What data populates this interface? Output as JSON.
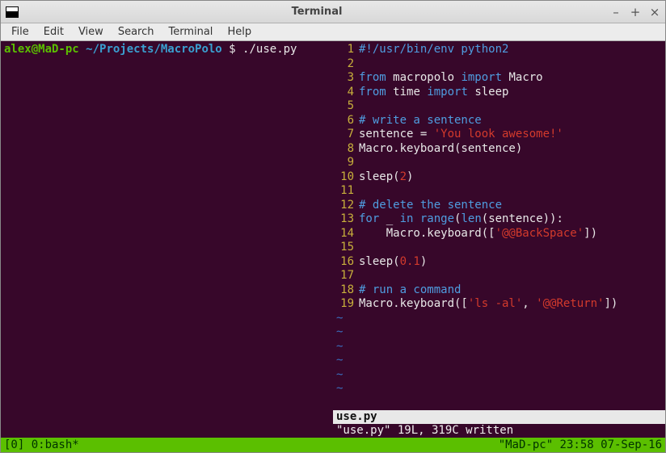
{
  "window": {
    "title": "Terminal",
    "minimize": "–",
    "maximize": "+",
    "close": "×"
  },
  "menubar": {
    "items": [
      "File",
      "Edit",
      "View",
      "Search",
      "Terminal",
      "Help"
    ]
  },
  "left_prompt": {
    "user": "alex@MaD-pc",
    "path": "~/Projects/MacroPolo",
    "symbol": "$",
    "command": "./use.py"
  },
  "editor": {
    "filename": "use.py",
    "status": "\"use.py\" 19L, 319C written",
    "tilde_rows": 6,
    "lines": [
      [
        {
          "t": "#!/usr/bin/env python2",
          "c": "sh"
        }
      ],
      [],
      [
        {
          "t": "from ",
          "c": "kw"
        },
        {
          "t": "macropolo ",
          "c": "id"
        },
        {
          "t": "import ",
          "c": "kw"
        },
        {
          "t": "Macro",
          "c": "id"
        }
      ],
      [
        {
          "t": "from ",
          "c": "kw"
        },
        {
          "t": "time ",
          "c": "id"
        },
        {
          "t": "import ",
          "c": "kw"
        },
        {
          "t": "sleep",
          "c": "id"
        }
      ],
      [],
      [
        {
          "t": "# write a sentence",
          "c": "sh"
        }
      ],
      [
        {
          "t": "sentence ",
          "c": "id"
        },
        {
          "t": "= ",
          "c": "punct"
        },
        {
          "t": "'You look awesome!'",
          "c": "str"
        }
      ],
      [
        {
          "t": "Macro.keyboard(sentence)",
          "c": "id"
        }
      ],
      [],
      [
        {
          "t": "sleep(",
          "c": "id"
        },
        {
          "t": "2",
          "c": "num"
        },
        {
          "t": ")",
          "c": "id"
        }
      ],
      [],
      [
        {
          "t": "# delete the sentence",
          "c": "sh"
        }
      ],
      [
        {
          "t": "for ",
          "c": "kw"
        },
        {
          "t": "_ ",
          "c": "id"
        },
        {
          "t": "in ",
          "c": "kw"
        },
        {
          "t": "range",
          "c": "fn"
        },
        {
          "t": "(",
          "c": "punct"
        },
        {
          "t": "len",
          "c": "fn"
        },
        {
          "t": "(sentence)):",
          "c": "id"
        }
      ],
      [
        {
          "t": "    Macro.keyboard([",
          "c": "id"
        },
        {
          "t": "'@@BackSpace'",
          "c": "str"
        },
        {
          "t": "])",
          "c": "id"
        }
      ],
      [],
      [
        {
          "t": "sleep(",
          "c": "id"
        },
        {
          "t": "0.1",
          "c": "num"
        },
        {
          "t": ")",
          "c": "id"
        }
      ],
      [],
      [
        {
          "t": "# run a command",
          "c": "sh"
        }
      ],
      [
        {
          "t": "Macro.keyboard([",
          "c": "id"
        },
        {
          "t": "'ls -al'",
          "c": "str"
        },
        {
          "t": ", ",
          "c": "punct"
        },
        {
          "t": "'@@Return'",
          "c": "str"
        },
        {
          "t": "])",
          "c": "id"
        }
      ]
    ]
  },
  "tmux": {
    "left": "[0] 0:bash*",
    "right": "\"MaD-pc\" 23:58 07-Sep-16"
  }
}
